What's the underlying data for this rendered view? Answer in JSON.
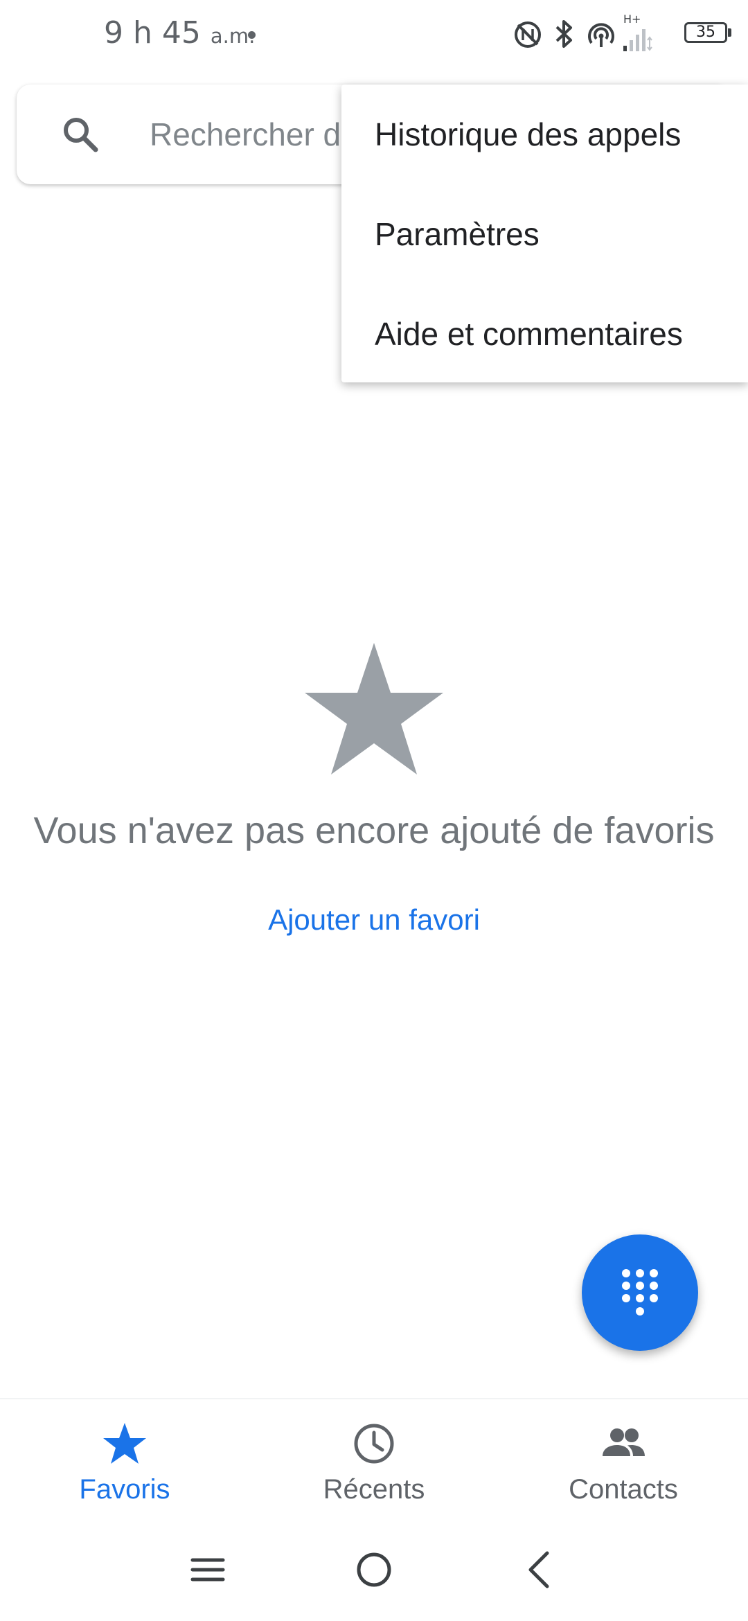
{
  "status_bar": {
    "time": "9 h 45",
    "ampm": "a.m.",
    "network_label": "H+",
    "battery_level": "35"
  },
  "search": {
    "placeholder": "Rechercher des contacts et des lieux",
    "value": ""
  },
  "overflow_menu": {
    "items": [
      {
        "label": "Historique des appels"
      },
      {
        "label": "Paramètres"
      },
      {
        "label": "Aide et commentaires"
      }
    ]
  },
  "empty_state": {
    "icon": "star-icon",
    "message": "Vous n'avez pas encore ajouté de favoris",
    "action_label": "Ajouter un favori"
  },
  "fab": {
    "icon": "dialpad-icon"
  },
  "bottom_nav": {
    "items": [
      {
        "label": "Favoris",
        "icon": "star-icon",
        "active": true
      },
      {
        "label": "Récents",
        "icon": "clock-icon",
        "active": false
      },
      {
        "label": "Contacts",
        "icon": "people-icon",
        "active": false
      }
    ]
  },
  "system_nav": {
    "buttons": [
      "menu-icon",
      "home-icon",
      "back-icon"
    ]
  },
  "colors": {
    "accent": "#1a73e8",
    "icon_gray": "#5f6368",
    "empty_star": "#9aa0a6",
    "secondary_text": "#70757a"
  }
}
